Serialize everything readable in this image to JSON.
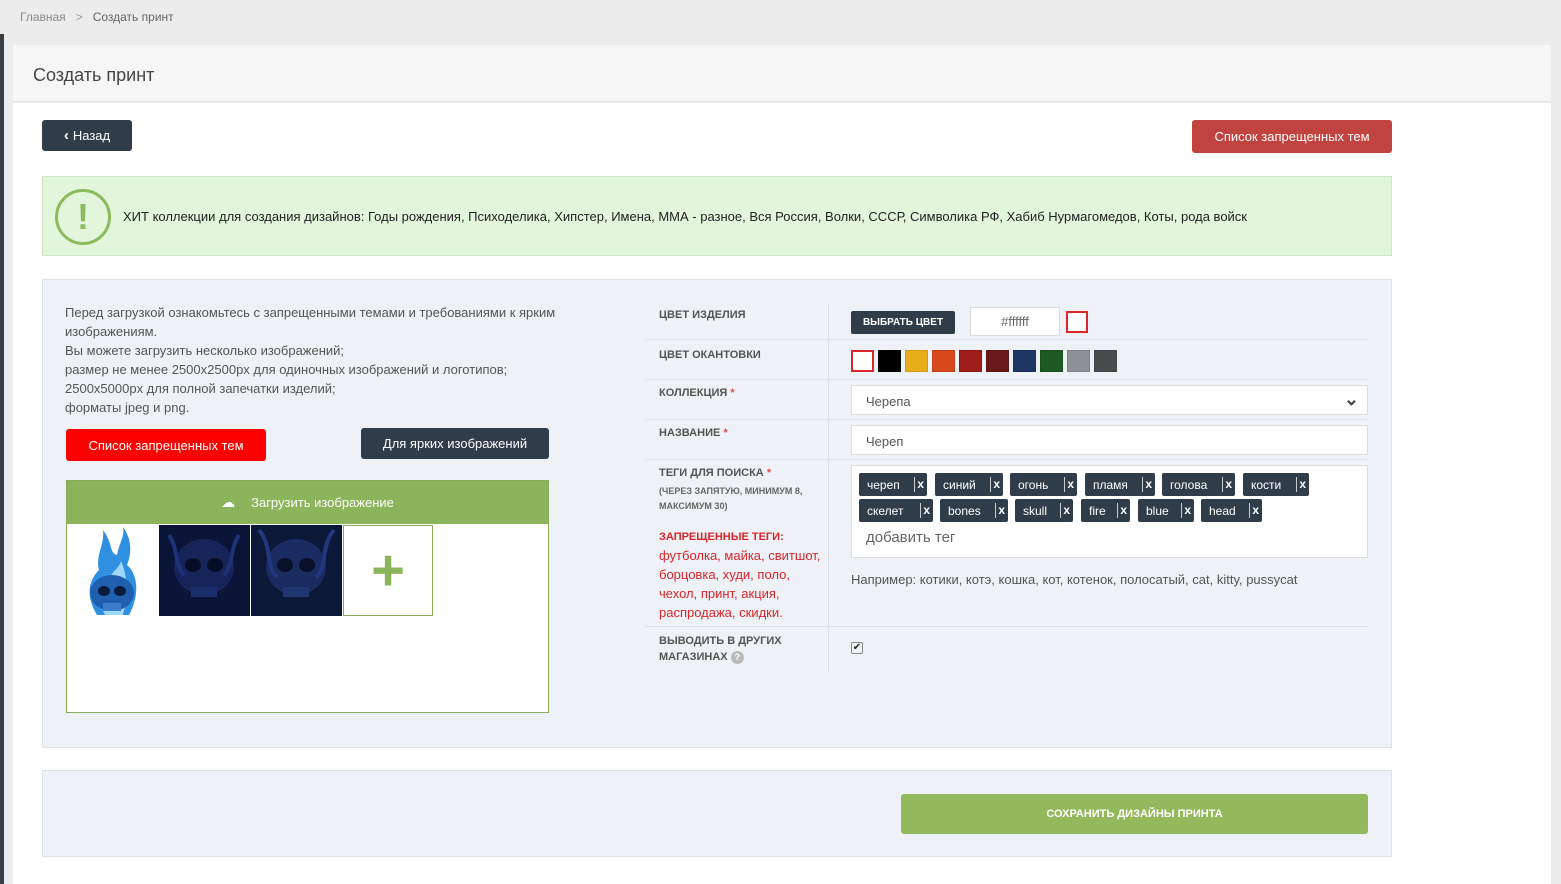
{
  "breadcrumb": {
    "home": "Главная",
    "separator": ">",
    "current": "Создать принт"
  },
  "page": {
    "title": "Создать принт"
  },
  "toolbar": {
    "back_label": "Назад",
    "forbidden_label": "Список запрещенных тем"
  },
  "alert": {
    "icon": "exclamation-icon",
    "text": "ХИТ коллекции для создания дизайнов: Годы рождения, Психоделика, Хипстер, Имена, ММА - разное, Вся Россия, Волки, СССР, Символика РФ, Хабиб Нурмагомедов, Коты, рода войск"
  },
  "info": {
    "lines": [
      "Перед загрузкой ознакомьтесь с запрещенными темами и требованиями к ярким изображениям.",
      "Вы можете загрузить несколько изображений;",
      "размер не менее 2500x2500px для одиночных изображений и логотипов;",
      "2500x5000px для полной запечатки изделий;",
      "форматы jpeg и png."
    ],
    "forbidden_button": "Список запрещенных тем",
    "bright_button": "Для ярких изображений"
  },
  "upload": {
    "label": "Загрузить изображение",
    "add_label": "+"
  },
  "form": {
    "product_color": {
      "label": "ЦВЕТ ИЗДЕЛИЯ",
      "pick_button": "ВЫБРАТЬ ЦВЕТ",
      "value": "#ffffff"
    },
    "trim_color": {
      "label": "ЦВЕТ ОКАНТОВКИ",
      "swatches": [
        "#ffffff",
        "#000000",
        "#e8ae19",
        "#d8481e",
        "#9e1c1a",
        "#6b1a1a",
        "#1f3566",
        "#1c5a22",
        "#8f9196",
        "#4a4b4c"
      ]
    },
    "collection": {
      "label": "КОЛЛЕКЦИЯ",
      "required": "*",
      "value": "Черепа"
    },
    "name": {
      "label": "НАЗВАНИЕ",
      "required": "*",
      "value": "Череп"
    },
    "tags": {
      "label": "ТЕГИ ДЛЯ ПОИСКА",
      "required": "*",
      "sub": "(ЧЕРЕЗ ЗАПЯТУЮ, МИНИМУМ 8, МАКСИМУМ 30)",
      "items": [
        "череп",
        "синий",
        "огонь",
        "пламя",
        "голова",
        "кости",
        "скелет",
        "bones",
        "skull",
        "fire",
        "blue",
        "head"
      ],
      "remove": "x",
      "placeholder": "добавить тег",
      "hint": "Например: котики, котэ, кошка, кот, котенок, полосатый, cat, kitty, pussycat"
    },
    "forbidden_tags": {
      "title": "ЗАПРЕЩЕННЫЕ ТЕГИ:",
      "list": "футболка, майка, свитшот, борцовка, худи, поло, чехол, принт, акция, распродажа, скидки."
    },
    "other_shops": {
      "label": "ВЫВОДИТЬ В ДРУГИХ МАГАЗИНАХ",
      "help": "?",
      "checked": "✔"
    }
  },
  "footer": {
    "save_label": "СОХРАНИТЬ ДИЗАЙНЫ ПРИНТА"
  }
}
